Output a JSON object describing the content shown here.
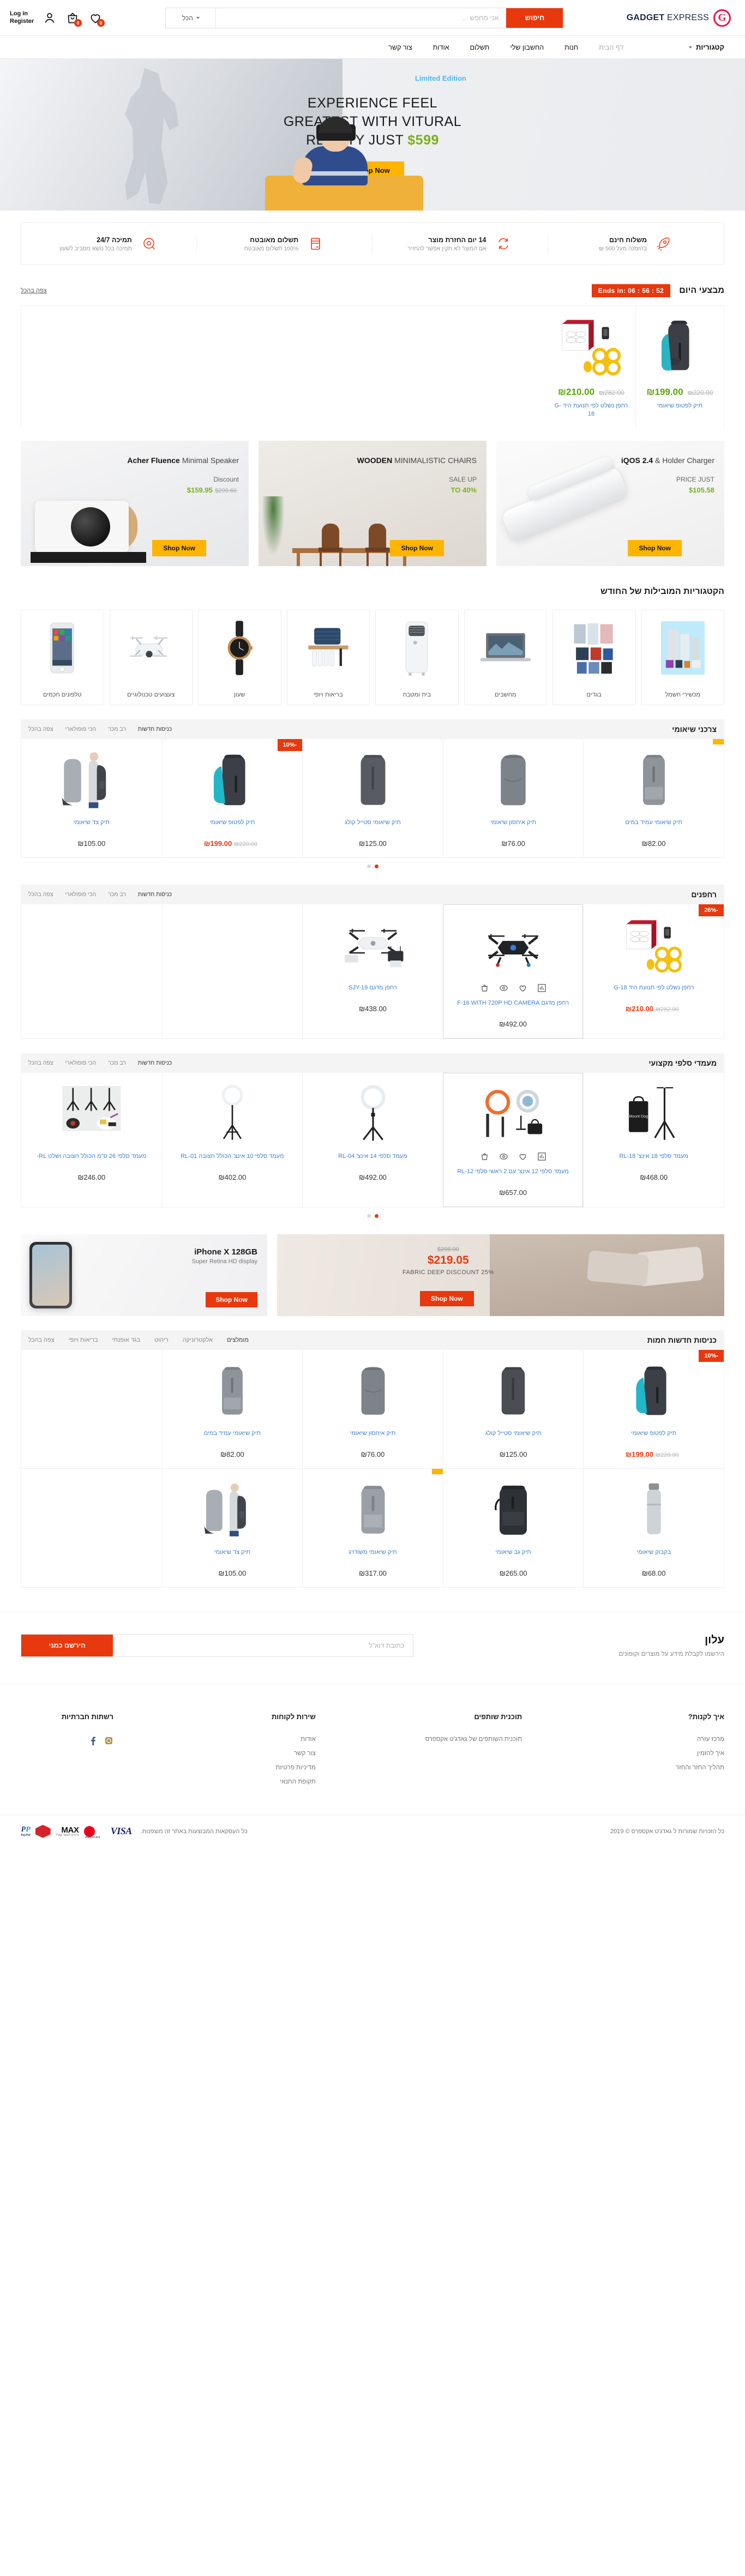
{
  "header": {
    "logo_letter": "G",
    "logo_bold": "GADGET",
    "logo_light": " EXPRESS",
    "search_placeholder": "אני מחפש ...",
    "search_value": "",
    "search_button": "חיפוש",
    "search_category": "הכל",
    "login_line1": "Log in",
    "login_line2": "Register",
    "cart_count": "0",
    "wishlist_count": "0"
  },
  "nav": {
    "categories_label": "קטגוריות",
    "links": [
      {
        "label": "דף הבית",
        "muted": true
      },
      {
        "label": "חנות",
        "muted": false
      },
      {
        "label": "החשבון שלי",
        "muted": false
      },
      {
        "label": "תשלום",
        "muted": false
      },
      {
        "label": "אודות",
        "muted": false
      },
      {
        "label": "צור קשר",
        "muted": false
      }
    ]
  },
  "hero": {
    "eyebrow": "Limited Edition",
    "line1": "EXPERIENCE FEEL",
    "line2": "GREATEST WITH VITURAL",
    "line3a": "REALITY JUST",
    "price": "$599",
    "cta": "Shop Now"
  },
  "features": [
    {
      "title": "משלוח חינם",
      "sub": "בהזמנה מעל 500 ₪",
      "icon": "rocket-icon"
    },
    {
      "title": "14 יום החזרת מוצר",
      "sub": "אם המוצר לא תקין אפשר להחזיר",
      "icon": "return-arrows-icon"
    },
    {
      "title": "תשלום מאובטח",
      "sub": "100% תשלום מאובטח",
      "icon": "credit-card-icon"
    },
    {
      "title": "תמיכה 24/7",
      "sub": "תמיכה בכל נושא מסביב לשעון",
      "icon": "support-headset-icon"
    }
  ],
  "deals": {
    "title": "מבצעי היום",
    "countdown": "Ends in:  06 : 56 : 52",
    "view_all": "צפה בהכל",
    "items": [
      {
        "name": "תיק לפטופ שיאומי",
        "price_new": "₪199.00",
        "price_old": "₪220.00",
        "image": "backpack-teal-lining"
      },
      {
        "name": "רחפן נשלט לפי תנועת היד G-18",
        "price_new": "₪210.00",
        "price_old": "₪282.00",
        "image": "drone-yellow-box"
      }
    ]
  },
  "promos": [
    {
      "title_bold": "Acher Fluence",
      "title_light": " Minimal Speaker",
      "sub": "Discount",
      "price_new": "$159.95",
      "price_old": "$299.60",
      "cta": "Shop Now",
      "art": "speaker"
    },
    {
      "title_bold": "WOODEN",
      "title_light": " MINIMALISTIC CHAIRS",
      "sub": "SALE UP",
      "price_new": "TO 40%",
      "price_old": "",
      "cta": "Shop Now",
      "art": "chairs"
    },
    {
      "title_bold": "iQOS 2.4",
      "title_light": " & Holder Charger",
      "sub": "PRICE JUST",
      "price_new": "$105.58",
      "price_old": "",
      "cta": "Shop Now",
      "art": "iqos"
    }
  ],
  "categories": {
    "title": "הקטגוריות המובילות של החודש",
    "items": [
      {
        "label": "טלפונים חכמים",
        "icon": "smartphone"
      },
      {
        "label": "צעצועים טכנולוגיים",
        "icon": "drone"
      },
      {
        "label": "שעון",
        "icon": "watch"
      },
      {
        "label": "בריאות ויופי",
        "icon": "cosmetics"
      },
      {
        "label": "בית ומטבח",
        "icon": "air-conditioner"
      },
      {
        "label": "מחשבים",
        "icon": "laptop"
      },
      {
        "label": "בגדים",
        "icon": "clothes"
      },
      {
        "label": "מכשירי חשמל",
        "icon": "appliances"
      }
    ]
  },
  "tab_labels": [
    "כניסות חדשות",
    "רב מכר",
    "הכי פופולארי",
    "צפה בהכל"
  ],
  "section_backpacks": {
    "title": "צרכני שיאומי",
    "products": [
      {
        "name": "תיק שיאומי עמיד במים",
        "price": "₪82.00",
        "tag": "",
        "tag_type": "yellow",
        "image": "backpack-gray-tall"
      },
      {
        "name": "תיק איחסון שיאומי",
        "price": "₪76.00",
        "tag": "",
        "tag_type": "",
        "image": "backpack-gray-soft"
      },
      {
        "name": "תיק שיאומי סטייל קולג",
        "price": "₪125.00",
        "tag": "",
        "tag_type": "",
        "image": "backpack-dark-gray"
      },
      {
        "name": "תיק לפטופ שיאומי",
        "price": "₪199.00",
        "price_old": "₪220.00",
        "tag": "10%-",
        "tag_type": "red",
        "image": "backpack-teal-open"
      },
      {
        "name": "תיק צד שיאומי",
        "price": "₪105.00",
        "tag": "",
        "tag_type": "",
        "image": "sling-bag-model"
      }
    ]
  },
  "section_drones": {
    "title": "רחפנים",
    "products": [
      {
        "name": "רחפן נשלט לפי תנועת היד G-18",
        "price": "₪210.00",
        "price_old": "₪282.00",
        "tag": "26%-",
        "tag_type": "red",
        "image": "drone-yellow-box"
      },
      {
        "name": "רחפן מדגם F-16 WITH 720P HD CAMERA",
        "price": "₪492.00",
        "tag": "",
        "tag_type": "",
        "image": "drone-black",
        "selected": true
      },
      {
        "name": "רחפן מדגם SJY-19",
        "price": "₪438.00",
        "tag": "",
        "tag_type": "",
        "image": "drone-white"
      },
      {
        "name": "",
        "price": "",
        "tag": "",
        "tag_type": "",
        "image": ""
      },
      {
        "name": "",
        "price": "",
        "tag": "",
        "tag_type": "",
        "image": ""
      }
    ]
  },
  "section_lights": {
    "title": "מעמדי סלפי מקצועי",
    "products": [
      {
        "name": "מעמד סלפי 18 אינצ' RL-18",
        "price": "₪468.00",
        "tag": "",
        "tag_type": "",
        "image": "ringlight-bag"
      },
      {
        "name": "מעמד סלפי 12 אינצ' עם 2 ראשי סלפי RL-12",
        "price": "₪657.00",
        "tag": "",
        "tag_type": "",
        "image": "ringlight-kit",
        "selected": true
      },
      {
        "name": "מעמד סלפי 14 אינצ' RL-04",
        "price": "₪492.00",
        "tag": "",
        "tag_type": "",
        "image": "ringlight-stand-14"
      },
      {
        "name": "מעמד סלפי 10 אינצ' הכולל חצובה RL-01",
        "price": "₪402.00",
        "tag": "",
        "tag_type": "",
        "image": "ringlight-stand-10"
      },
      {
        "name": "מעמד סלפי 26 ס\"מ הכולל חצובה ושלט RL-",
        "price": "₪246.00",
        "tag": "",
        "tag_type": "",
        "image": "ringlight-trio"
      }
    ]
  },
  "mid_banners": {
    "left": {
      "price_old": "$298.00",
      "price_new": "$219.05",
      "caption": "FABRIC DEEP DISCOUNT 25%",
      "cta": "Shop Now"
    },
    "right": {
      "title": "iPhone X 128GB",
      "sub": "Super Retina HD display",
      "cta": "Shop Now"
    }
  },
  "new_arrivals": {
    "title": "כניסות חדשות חמות",
    "tabs": [
      "מומלצים",
      "אלקטרוניקה",
      "ריהוט",
      "בגד אופנתי",
      "בריאות ויופי",
      "צפה בהכל"
    ],
    "products": [
      {
        "name": "תיק לפטופ שיאומי",
        "price": "₪199.00",
        "price_old": "₪220.00",
        "tag": "10%-",
        "tag_type": "red",
        "image": "backpack-teal-open"
      },
      {
        "name": "תיק שיאומי סטייל קולג",
        "price": "₪125.00",
        "tag": "",
        "tag_type": "",
        "image": "backpack-dark-gray"
      },
      {
        "name": "תיק איחסון שיאומי",
        "price": "₪76.00",
        "tag": "",
        "tag_type": "",
        "image": "backpack-gray-soft"
      },
      {
        "name": "תיק שיאומי עמיד במים",
        "price": "₪82.00",
        "tag": "",
        "tag_type": "",
        "image": "backpack-gray-tall"
      },
      {
        "name": "בקבוק שיאומי",
        "price": "₪68.00",
        "tag": "",
        "tag_type": "",
        "image": "bottle"
      },
      {
        "name": "תיק גב שיאומי",
        "price": "₪265.00",
        "tag": "",
        "tag_type": "",
        "image": "backpack-black-big"
      },
      {
        "name": "תיק שיאומי משודרג",
        "price": "₪317.00",
        "tag": "",
        "tag_type": "yellow",
        "image": "backpack-gray-urban"
      },
      {
        "name": "תיק צד שיאומי",
        "price": "₪105.00",
        "tag": "",
        "tag_type": "",
        "image": "sling-bag-model"
      }
    ]
  },
  "newsletter": {
    "title": "עלון",
    "sub": "הירשמו לקבלת מידע על מוצרים וקופונים",
    "placeholder": "כתובת דוא\"ל",
    "value": "",
    "button": "הירשם כמני"
  },
  "footer": {
    "columns": [
      {
        "heading": "איך לקנות?",
        "links": [
          "מרכז עזרה",
          "איך להזמין",
          "תהליך החזר והחזר"
        ]
      },
      {
        "heading": "תוכנית שותפים",
        "links": [
          "תוכנית השותפים של גאדג'ט אקספרס"
        ]
      },
      {
        "heading": "שירות לקוחות",
        "links": [
          "אודות",
          "צור קשר",
          "מדיניות פרטיות",
          "תקופת התנאי"
        ]
      },
      {
        "heading": "רשתות חברתיות",
        "links": []
      }
    ],
    "socials": [
      "facebook-icon",
      "instagram-icon"
    ],
    "copyright": "כל הזכויות שמורות ל גאדג'ט אקספרס © 2019",
    "pay_note": "כל העסקאות המבוצעות באתר זה מוצפנות.",
    "payments": [
      "visa",
      "mastercard",
      "max",
      "isracard",
      "paypal"
    ]
  }
}
